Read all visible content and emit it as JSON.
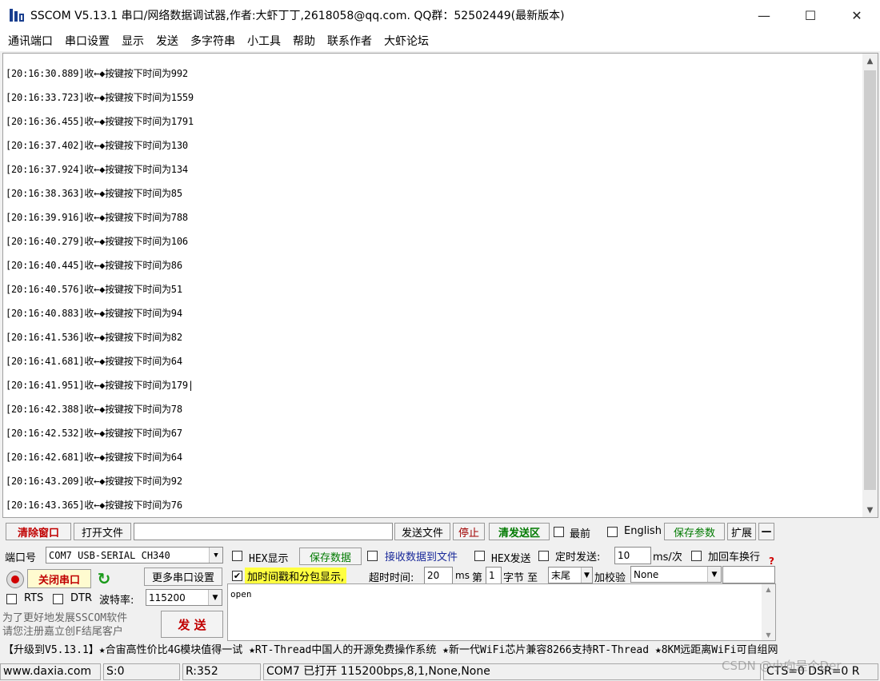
{
  "window": {
    "title": "SSCOM V5.13.1 串口/网络数据调试器,作者:大虾丁丁,2618058@qq.com. QQ群：52502449(最新版本)",
    "minimize": "—",
    "maximize": "☐",
    "close": "✕"
  },
  "menu": [
    "通讯端口",
    "串口设置",
    "显示",
    "发送",
    "多字符串",
    "小工具",
    "帮助",
    "联系作者",
    "大虾论坛"
  ],
  "receive": {
    "lines": [
      "[20:16:30.889]收←◆按键按下时间为992",
      "[20:16:33.723]收←◆按键按下时间为1559",
      "[20:16:36.455]收←◆按键按下时间为1791",
      "[20:16:37.402]收←◆按键按下时间为130",
      "[20:16:37.924]收←◆按键按下时间为134",
      "[20:16:38.363]收←◆按键按下时间为85",
      "[20:16:39.916]收←◆按键按下时间为788",
      "[20:16:40.279]收←◆按键按下时间为106",
      "[20:16:40.445]收←◆按键按下时间为86",
      "[20:16:40.576]收←◆按键按下时间为51",
      "[20:16:40.883]收←◆按键按下时间为94",
      "[20:16:41.536]收←◆按键按下时间为82",
      "[20:16:41.681]收←◆按键按下时间为64",
      "[20:16:41.951]收←◆按键按下时间为179|",
      "[20:16:42.388]收←◆按键按下时间为78",
      "[20:16:42.532]收←◆按键按下时间为67",
      "[20:16:42.681]收←◆按键按下时间为64",
      "[20:16:43.209]收←◆按键按下时间为92",
      "[20:16:43.365]收←◆按键按下时间为76"
    ]
  },
  "toolbar": {
    "clear": "清除窗口",
    "open_file": "打开文件",
    "file_path": "",
    "send_file": "发送文件",
    "stop": "停止",
    "clear_send": "清发送区",
    "latest": "最前",
    "english": "English",
    "save_params": "保存参数",
    "expand": "扩展",
    "collapse": "—"
  },
  "settings": {
    "port_label": "端口号",
    "port_value": "COM7 USB-SERIAL CH340",
    "hex_display": "HEX显示",
    "save_data": "保存数据",
    "recv_to_file": "接收数据到文件",
    "hex_send": "HEX发送",
    "timed_send": "定时发送:",
    "interval": "10",
    "interval_unit": "ms/次",
    "append_newline": "加回车换行",
    "close_port": "关闭串口",
    "more_settings": "更多串口设置",
    "timestamp": "加时间戳和分包显示,",
    "timeout_label": "超时时间:",
    "timeout_value": "20",
    "timeout_unit": "ms",
    "byte_from_label": "第",
    "byte_from": "1",
    "byte_unit": "字节 至",
    "byte_to": "末尾",
    "checksum_label": "加校验",
    "checksum_value": "None",
    "rts": "RTS",
    "dtr": "DTR",
    "baud_label": "波特率:",
    "baud_value": "115200",
    "promo_line1": "为了更好地发展SSCOM软件",
    "promo_line2": "请您注册嘉立创F结尾客户",
    "send_button": "发 送",
    "send_text": "open"
  },
  "ticker": "【升级到V5.13.1】★合宙高性价比4G模块值得一试 ★RT-Thread中国人的开源免费操作系统 ★新一代WiFi芯片兼容8266支持RT-Thread ★8KM远距离WiFi可自组网",
  "status": {
    "website": "www.daxia.com",
    "sent": "S:0",
    "received": "R:352",
    "port_status": "COM7 已打开  115200bps,8,1,None,None",
    "signals": "CTS=0 DSR=0 R"
  },
  "watermark": "CSDN @小向是个Der"
}
